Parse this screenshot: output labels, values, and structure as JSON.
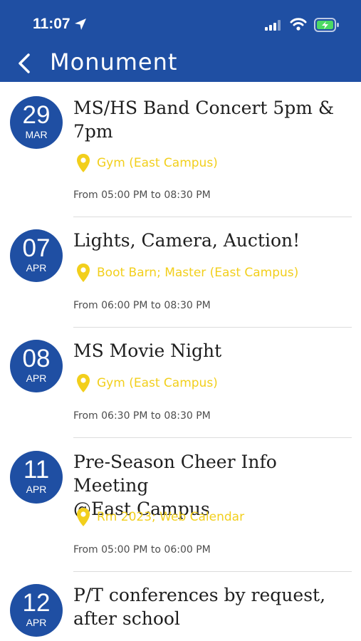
{
  "status_bar": {
    "time": "11:07"
  },
  "nav": {
    "title": "Monument"
  },
  "events": [
    {
      "day": "29",
      "month": "MAR",
      "title_line1": "MS/HS Band Concert 5pm &",
      "title_line2": "7pm",
      "location": "Gym (East Campus)",
      "time": "From 05:00 PM to 08:30 PM"
    },
    {
      "day": "07",
      "month": "APR",
      "title_line1": "Lights, Camera, Auction!",
      "title_line2": "",
      "location": "Boot Barn; Master (East Campus)",
      "time": "From 06:00 PM to 08:30 PM"
    },
    {
      "day": "08",
      "month": "APR",
      "title_line1": "MS Movie Night",
      "title_line2": "",
      "location": "Gym (East Campus)",
      "time": "From 06:30 PM to 08:30 PM"
    },
    {
      "day": "11",
      "month": "APR",
      "title_line1": "Pre-Season Cheer Info Meeting",
      "title_line2": "@East Campus",
      "location": "Rm 2023; Web Calendar",
      "time": "From 05:00 PM to 06:00 PM"
    },
    {
      "day": "12",
      "month": "APR",
      "title_line1": "P/T conferences by request,",
      "title_line2": "after school",
      "location": "",
      "time": ""
    }
  ],
  "colors": {
    "header": "#1f4fa3",
    "badge": "#1f4fa3",
    "location": "#f2cf1c",
    "battery": "#4cd964"
  },
  "icons": {
    "back": "chevron-left-icon",
    "location": "location-arrow-icon",
    "pin": "map-pin-icon",
    "signal": "cellular-signal-icon",
    "wifi": "wifi-icon",
    "battery": "battery-charging-icon"
  }
}
